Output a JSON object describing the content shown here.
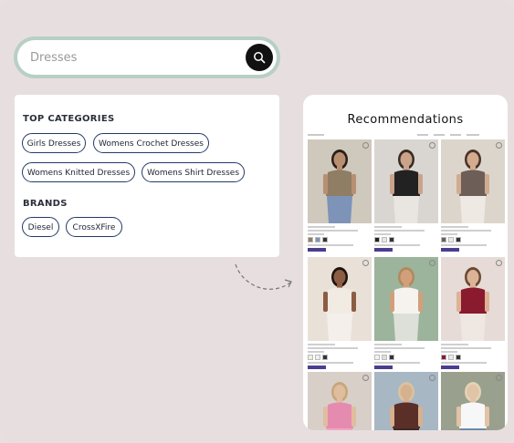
{
  "search": {
    "query": "Dresses"
  },
  "dropdown": {
    "top_categories_title": "TOP CATEGORIES",
    "categories": [
      "Girls Dresses",
      "Womens Crochet Dresses",
      "Womens Knitted Dresses",
      "Womens Shirt Dresses"
    ],
    "brands_title": "BRANDS",
    "brands": [
      "Diesel",
      "CrossXFire"
    ]
  },
  "recommendations": {
    "title": "Recommendations",
    "products": [
      {
        "bg": "#cfc8bc",
        "top": "#8f7d64",
        "bottom": "#7d93b8",
        "skin": "#b98f72",
        "hair": "#2a1f19"
      },
      {
        "bg": "#d9d6d2",
        "top": "#222222",
        "bottom": "#e9e6e2",
        "skin": "#c9a38a",
        "hair": "#3a2c22"
      },
      {
        "bg": "#dcd5cc",
        "top": "#6d5f57",
        "bottom": "#efe9e4",
        "skin": "#d3ab8f",
        "hair": "#4a3427"
      },
      {
        "bg": "#e9e1d8",
        "top": "#f1ebe4",
        "bottom": "#f4efea",
        "skin": "#8c5d43",
        "hair": "#1c1410"
      },
      {
        "bg": "#9cb49c",
        "top": "#f6f3ef",
        "bottom": "#dce0d8",
        "skin": "#d1a07b",
        "hair": "#b08a5e"
      },
      {
        "bg": "#e6dbd6",
        "top": "#8a1a2e",
        "bottom": "#efe7e2",
        "skin": "#dcb397",
        "hair": "#6b4a33"
      },
      {
        "bg": "#d8cfc9",
        "top": "#e68bb0",
        "bottom": "#f2a6c4",
        "skin": "#e0bd9f",
        "hair": "#c7a779"
      },
      {
        "bg": "#a8b7c4",
        "top": "#5a2f28",
        "bottom": "#3c2a25",
        "skin": "#d7b08f",
        "hair": "#d9c3a0"
      },
      {
        "bg": "#9aa08e",
        "top": "#f7f7f7",
        "bottom": "#6b8aa8",
        "skin": "#e1c3a8",
        "hair": "#e3d4b2"
      }
    ]
  }
}
